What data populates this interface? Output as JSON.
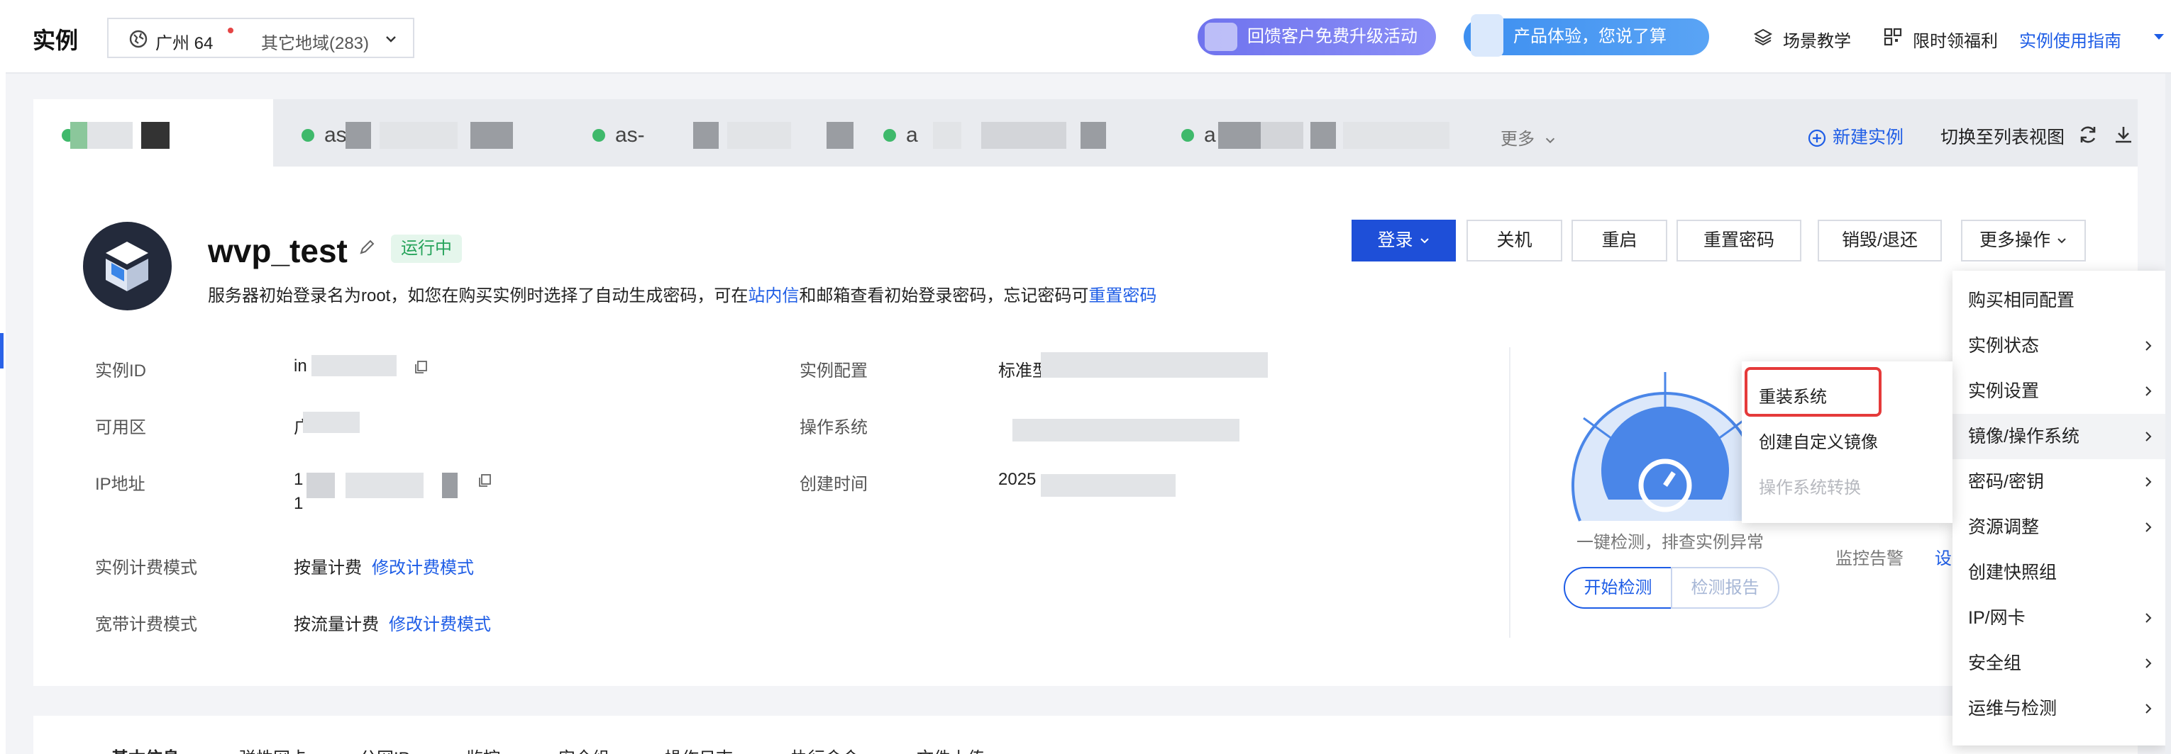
{
  "header": {
    "page_title": "实例",
    "region": {
      "name": "广州 64",
      "other": "其它地域(283)"
    },
    "promo1": "回馈客户免费升级活动",
    "promo2": "产品体验，您说了算",
    "links": {
      "scene": "场景教学",
      "welfare": "限时领福利",
      "guide": "实例使用指南"
    }
  },
  "tabs": {
    "items": [
      {
        "prefix": ""
      },
      {
        "prefix": "as"
      },
      {
        "prefix": "as-"
      },
      {
        "prefix": "a"
      },
      {
        "prefix": "a"
      }
    ],
    "more": "更多",
    "new_instance": "新建实例",
    "switch_view": "切换至列表视图"
  },
  "instance": {
    "name": "wvp_test",
    "status": "运行中",
    "notice_prefix": "服务器初始登录名为root，如您在购买实例时选择了自动生成密码，可在",
    "notice_link1": "站内信",
    "notice_mid": "和邮箱查看初始登录密码，忘记密码可",
    "notice_link2": "重置密码"
  },
  "actions": {
    "login": "登录",
    "shutdown": "关机",
    "restart": "重启",
    "reset_password": "重置密码",
    "destroy": "销毁/退还",
    "more": "更多操作"
  },
  "info": {
    "instance_id_label": "实例ID",
    "instance_id_value": "in",
    "zone_label": "可用区",
    "zone_value": "广",
    "ip_label": "IP地址",
    "ip_value1": "1",
    "ip_value2": "1",
    "billing_label": "实例计费模式",
    "billing_value": "按量计费",
    "billing_link": "修改计费模式",
    "bw_label": "宽带计费模式",
    "bw_value": "按流量计费",
    "bw_link": "修改计费模式",
    "config_label": "实例配置",
    "config_value": "标准型",
    "os_label": "操作系统",
    "created_label": "创建时间",
    "created_value": "2025"
  },
  "diagnose": {
    "text": "一键检测，排查实例异常",
    "start": "开始检测",
    "report": "检测报告",
    "monitor": "监控告警",
    "monitor_link": "设"
  },
  "more_menu": {
    "items": [
      {
        "label": "购买相同配置"
      },
      {
        "label": "实例状态"
      },
      {
        "label": "实例设置"
      },
      {
        "label": "镜像/操作系统"
      },
      {
        "label": "密码/密钥"
      },
      {
        "label": "资源调整"
      },
      {
        "label": "创建快照组"
      },
      {
        "label": "IP/网卡"
      },
      {
        "label": "安全组"
      },
      {
        "label": "运维与检测"
      }
    ]
  },
  "sub_menu": {
    "items": [
      {
        "label": "重装系统"
      },
      {
        "label": "创建自定义镜像"
      },
      {
        "label": "操作系统转换"
      }
    ]
  },
  "bottom_tabs": [
    "基本信息",
    "弹性网卡",
    "公网IP",
    "监控",
    "安全组",
    "操作日志",
    "执行命令",
    "文件上传"
  ],
  "colors": {
    "accent": "#1e5de6",
    "primary_button": "#1e4fd8",
    "running_green": "#25a35a",
    "highlight_red": "#e53a3a"
  }
}
